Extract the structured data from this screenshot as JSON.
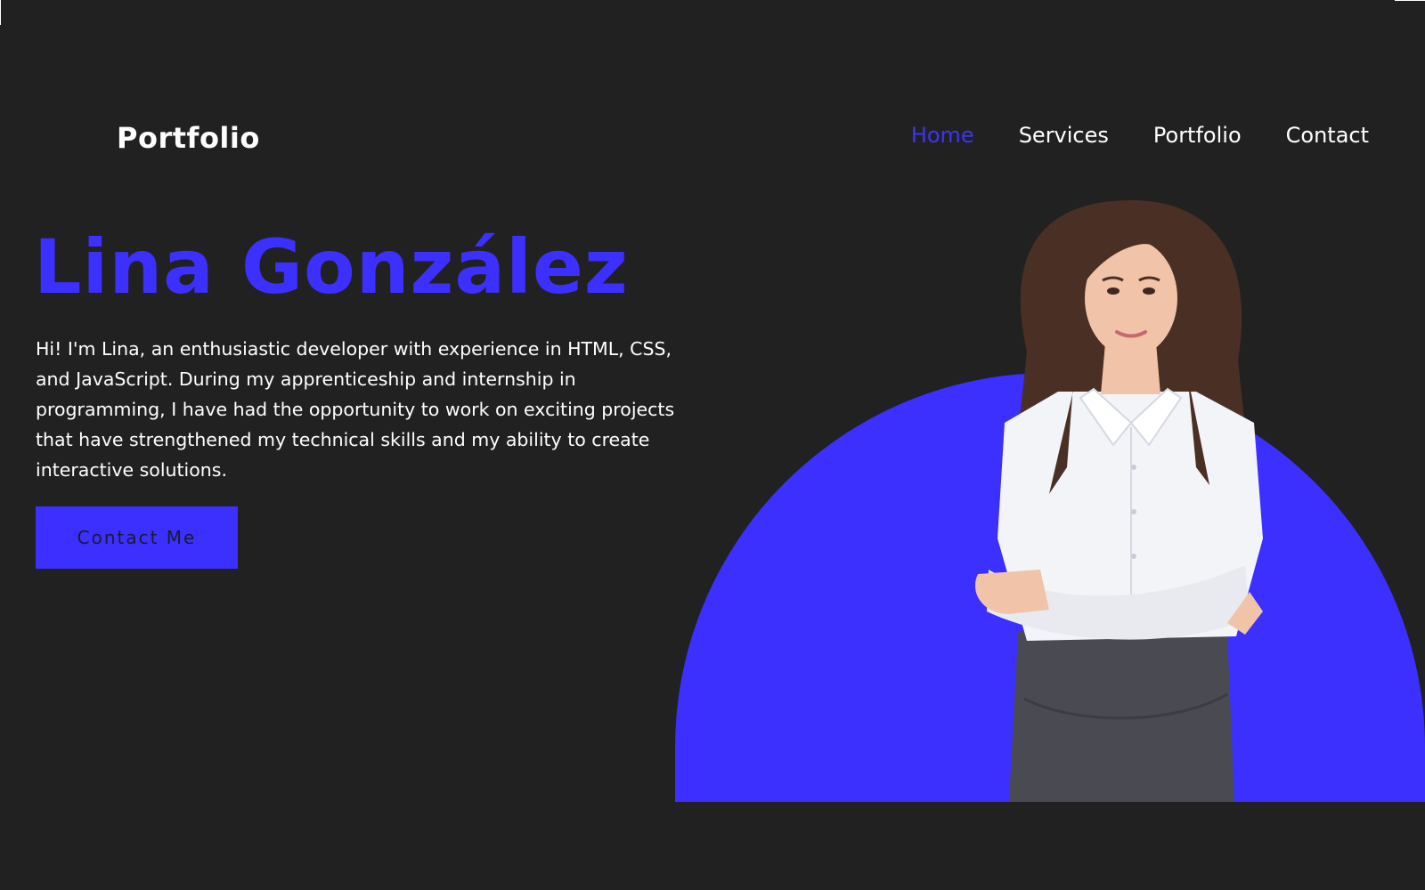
{
  "header": {
    "logo": "Portfolio",
    "nav": [
      {
        "label": "Home",
        "active": true
      },
      {
        "label": "Services",
        "active": false
      },
      {
        "label": "Portfolio",
        "active": false
      },
      {
        "label": "Contact",
        "active": false
      }
    ]
  },
  "hero": {
    "name": "Lina González",
    "intro": "Hi! I'm Lina, an enthusiastic developer with experience in HTML, CSS, and JavaScript. During my apprenticeship and internship in programming, I have had the opportunity to work on exciting projects that have strengthened my technical skills and my ability to create interactive solutions.",
    "cta_label": "Contact Me"
  },
  "colors": {
    "background": "#212121",
    "accent": "#3b30ff",
    "text": "#ffffff"
  }
}
